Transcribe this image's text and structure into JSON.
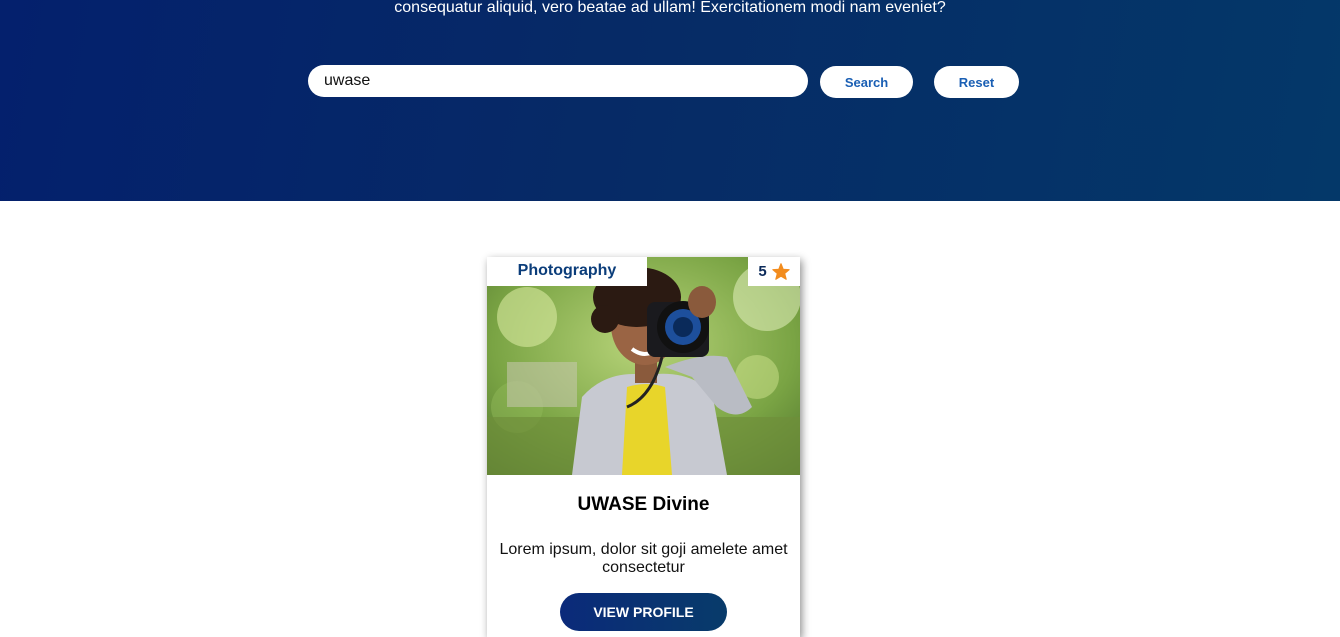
{
  "hero": {
    "tagline": "consequatur aliquid, vero beatae ad ullam! Exercitationem modi nam eveniet?"
  },
  "search": {
    "value": "uwase",
    "search_label": "Search",
    "reset_label": "Reset"
  },
  "card": {
    "category": "Photography",
    "rating": "5",
    "rating_icon": "star-icon",
    "name": "UWASE Divine",
    "description": "Lorem ipsum, dolor sit goji amelete amet consectetur",
    "button_label": "VIEW PROFILE",
    "photo_icon": "photographer-photo"
  },
  "colors": {
    "hero_start": "#04206d",
    "hero_end": "#043869",
    "accent_text": "#1a5fb4",
    "star": "#f28c1e"
  }
}
